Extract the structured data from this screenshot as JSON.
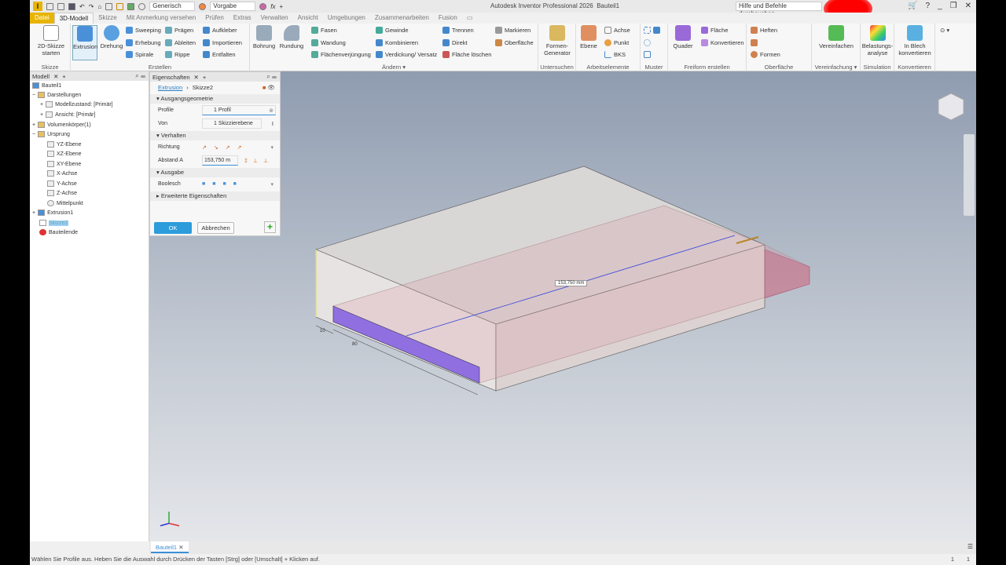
{
  "app": {
    "title": "Autodesk Inventor Professional 2026",
    "document": "Bauteil1",
    "search_placeholder": "Hilfe und Befehle durchsuchen...",
    "material": "Generisch",
    "appearance": "Vorgabe"
  },
  "tabs": [
    "Datei",
    "3D-Modell",
    "Skizze",
    "Mit Anmerkung versehen",
    "Prüfen",
    "Extras",
    "Verwalten",
    "Ansicht",
    "Umgebungen",
    "Zusammenarbeiten",
    "Fusion"
  ],
  "ribbon": {
    "groups": [
      "Skizze",
      "Erstellen",
      "Ändern ▾",
      "Untersuchen",
      "Arbeitselemente",
      "Muster",
      "Freiform erstellen",
      "Oberfläche",
      "Vereinfachung ▾",
      "Simulation",
      "Konvertieren"
    ],
    "big": [
      "2D-Skizze starten",
      "Extrusion",
      "Drehung",
      "Bohrung",
      "Rundung",
      "Formen-Generator",
      "Ebene",
      "Quader",
      "Vereinfachen",
      "Belastungs-analyse",
      "In Blech konvertieren"
    ],
    "small": [
      "Sweeping",
      "Erhebung",
      "Spirale",
      "Prägen",
      "Ableiten",
      "Rippe",
      "Aufkleber",
      "Importieren",
      "Entfalten",
      "Fasen",
      "Wandung",
      "Flächenverjüngung",
      "Gewinde",
      "Kombinieren",
      "Verdickung/ Versatz",
      "Trennen",
      "Direkt",
      "Fläche löschen",
      "Markieren",
      "Oberfläche",
      "Achse",
      "Punkt",
      "BKS",
      "Fläche",
      "Konvertieren",
      "Heften",
      "Formen"
    ]
  },
  "model_panel": {
    "tab": "Modell",
    "tree": [
      "Bauteil1",
      "Darstellungen",
      "Modellzustand: [Primär]",
      "Ansicht: [Primär]",
      "Volumenkörper(1)",
      "Ursprung",
      "YZ-Ebene",
      "XZ-Ebene",
      "XY-Ebene",
      "X-Achse",
      "Y-Achse",
      "Z-Achse",
      "Mittelpunkt",
      "Extrusion1",
      "Skizze2",
      "Bauteilende"
    ]
  },
  "properties": {
    "tab": "Eigenschaften",
    "breadcrumb": [
      "Extrusion",
      "Skizze2"
    ],
    "sections": [
      "Ausgangsgeometrie",
      "Verhalten",
      "Ausgabe",
      "Erweiterte Eigenschaften"
    ],
    "profile_label": "Profile",
    "profile_value": "1 Profil",
    "from_label": "Von",
    "from_value": "1 Skizzierebene",
    "direction_label": "Richtung",
    "distance_label": "Abstand A",
    "distance_value": "153,750 m",
    "boolean_label": "Boolesch",
    "ok": "OK",
    "cancel": "Abbrechen"
  },
  "viewport": {
    "dimension": "153,750 mm",
    "dim_small_1": "10",
    "dim_small_2": "80"
  },
  "doc_tab": "Bauteil1",
  "status": "Wählen Sie Profile aus. Heben Sie die Auswahl durch Drücken der Tasten [Strg] oder [Umschalt] + Klicken auf.",
  "status_right": [
    "1",
    "1"
  ]
}
